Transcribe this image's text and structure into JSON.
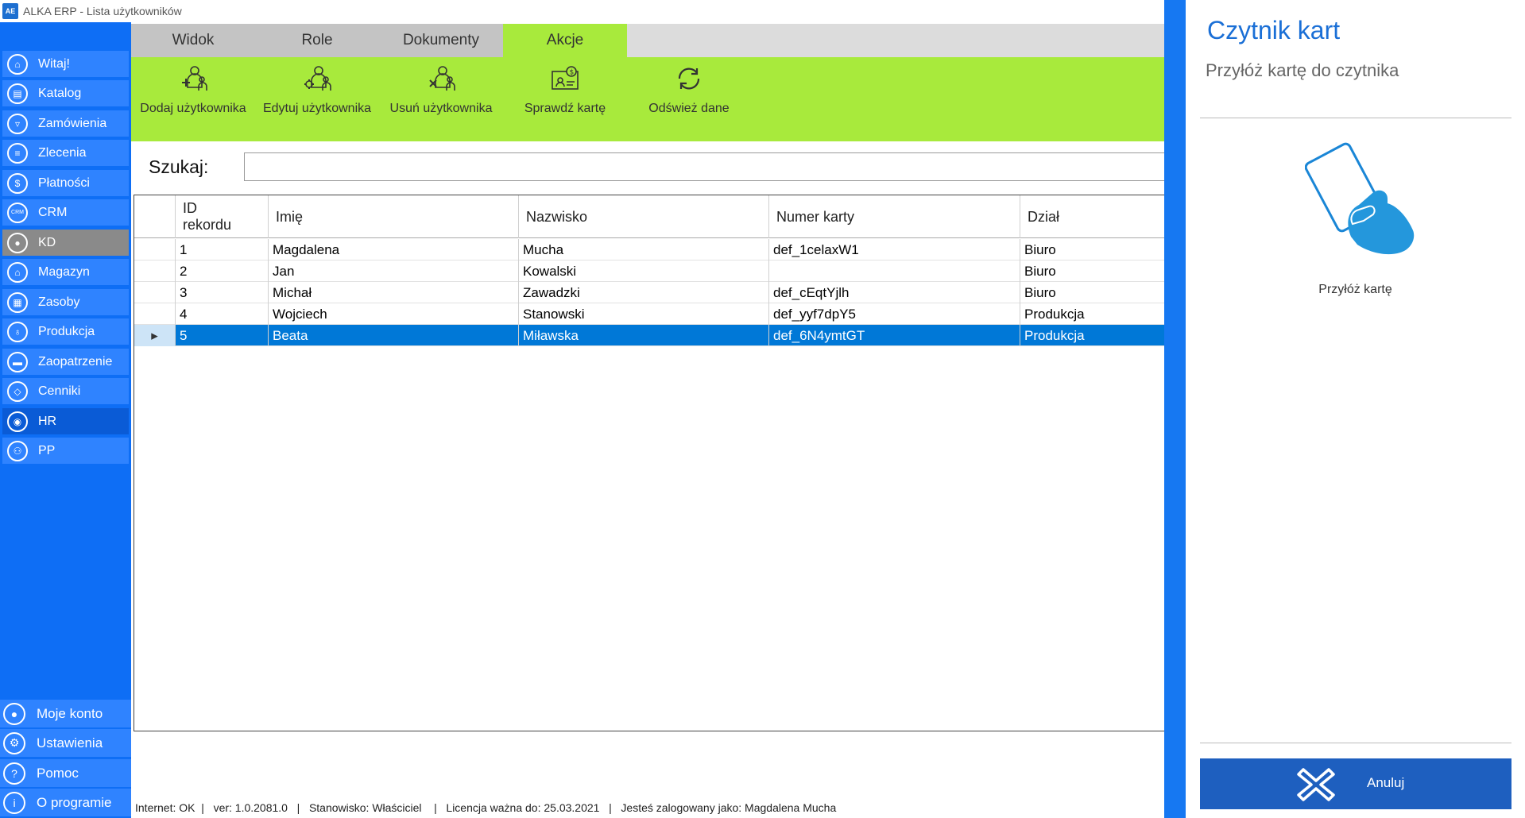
{
  "window": {
    "app_icon_text": "AE",
    "title": "ALKA ERP - Lista użytkowników"
  },
  "sidebar": {
    "items": [
      {
        "label": "Witaj!",
        "icon": "home-icon"
      },
      {
        "label": "Katalog",
        "icon": "book-icon"
      },
      {
        "label": "Zamówienia",
        "icon": "cart-icon"
      },
      {
        "label": "Zlecenia",
        "icon": "list-icon"
      },
      {
        "label": "Płatności",
        "icon": "dollar-icon"
      },
      {
        "label": "CRM",
        "icon": "crm-icon",
        "glyph": "CRM"
      },
      {
        "label": "KD",
        "icon": "user-lock-icon"
      },
      {
        "label": "Magazyn",
        "icon": "warehouse-icon"
      },
      {
        "label": "Zasoby",
        "icon": "box-icon"
      },
      {
        "label": "Produkcja",
        "icon": "factory-icon"
      },
      {
        "label": "Zaopatrzenie",
        "icon": "truck-icon"
      },
      {
        "label": "Cenniki",
        "icon": "tag-icon"
      },
      {
        "label": "HR",
        "icon": "hr-icon"
      },
      {
        "label": "PP",
        "icon": "pp-icon"
      }
    ],
    "bottom": [
      {
        "label": "Moje konto",
        "icon": "user-icon"
      },
      {
        "label": "Ustawienia",
        "icon": "gear-icon"
      },
      {
        "label": "Pomoc",
        "icon": "help-icon",
        "glyph": "?"
      },
      {
        "label": "O programie",
        "icon": "info-icon",
        "glyph": "i"
      }
    ]
  },
  "tabs": [
    {
      "label": "Widok"
    },
    {
      "label": "Role"
    },
    {
      "label": "Dokumenty"
    },
    {
      "label": "Akcje",
      "active": true
    }
  ],
  "ribbon": {
    "buttons": [
      {
        "label": "Dodaj użytkownika",
        "icon": "add-user-icon"
      },
      {
        "label": "Edytuj użytkownika",
        "icon": "edit-user-icon"
      },
      {
        "label": "Usuń użytkownika",
        "icon": "delete-user-icon"
      },
      {
        "label": "Sprawdź kartę",
        "icon": "check-card-icon"
      },
      {
        "label": "Odśwież dane",
        "icon": "refresh-icon"
      }
    ]
  },
  "search": {
    "label": "Szukaj:",
    "value": ""
  },
  "table": {
    "columns": [
      {
        "line1": "ID",
        "line2": "rekordu"
      },
      {
        "line1": "Imię"
      },
      {
        "line1": "Nazwisko"
      },
      {
        "line1": "Numer karty"
      },
      {
        "line1": "Dział"
      }
    ],
    "rows": [
      {
        "id": "1",
        "imie": "Magdalena",
        "nazwisko": "Mucha",
        "numer_karty": "def_1celaxW1",
        "dzial": "Biuro"
      },
      {
        "id": "2",
        "imie": "Jan",
        "nazwisko": "Kowalski",
        "numer_karty": "",
        "dzial": "Biuro"
      },
      {
        "id": "3",
        "imie": "Michał",
        "nazwisko": "Zawadzki",
        "numer_karty": "def_cEqtYjlh",
        "dzial": "Biuro"
      },
      {
        "id": "4",
        "imie": "Wojciech",
        "nazwisko": "Stanowski",
        "numer_karty": "def_yyf7dpY5",
        "dzial": "Produkcja"
      },
      {
        "id": "5",
        "imie": "Beata",
        "nazwisko": "Miławska",
        "numer_karty": "def_6N4ymtGT",
        "dzial": "Produkcja",
        "selected": true,
        "row_marker": "▸"
      }
    ]
  },
  "statusbar": {
    "text": "Internet: OK  |   ver: 1.0.2081.0   |   Stanowisko: Właściciel    |   Licencja ważna do: 25.03.2021   |   Jesteś zalogowany jako: Magdalena Mucha"
  },
  "card_panel": {
    "title": "Czytnik kart",
    "subtitle": "Przyłóż kartę do czytnika",
    "caption": "Przyłóż kartę",
    "cancel_label": "Anuluj",
    "illustration": "hand-card-icon"
  },
  "colors": {
    "sidebar": "#0e6ef5",
    "ribbon": "#a8ea3c",
    "selected_row": "#0078d7",
    "panel_accent": "#1678f2",
    "panel_title": "#1a6fd6",
    "cancel_button": "#1e5fbf"
  }
}
